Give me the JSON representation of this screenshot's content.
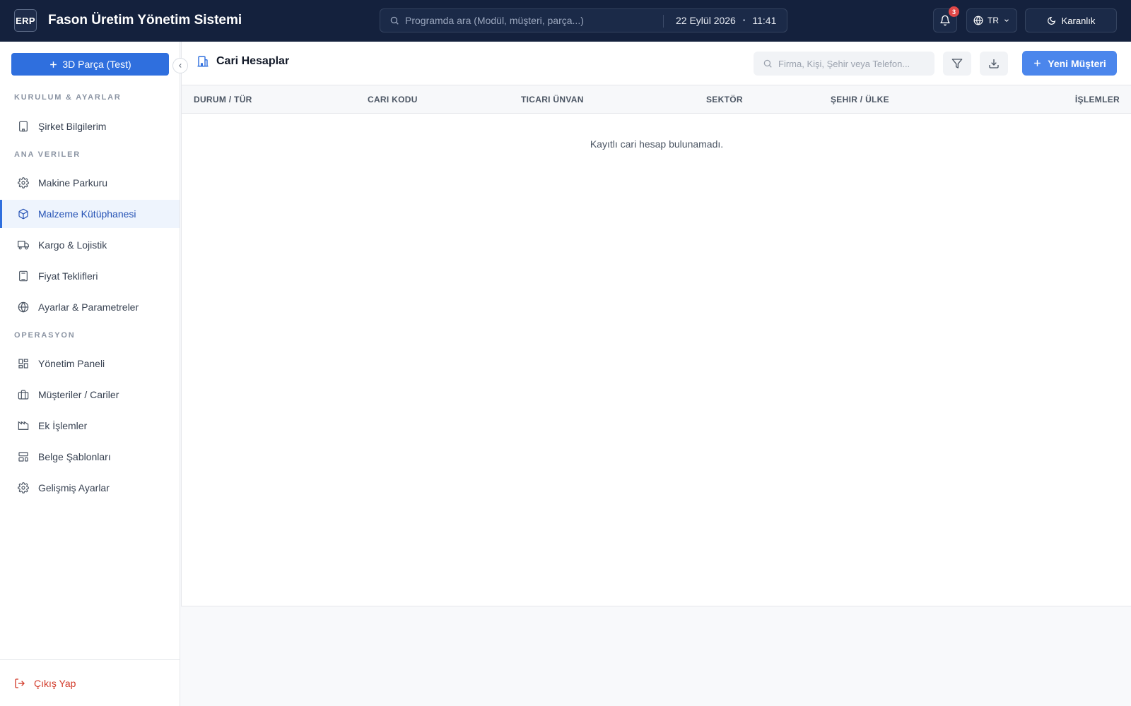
{
  "topbar": {
    "logo": "ERP",
    "app_title": "Fason Üretim Yönetim Sistemi",
    "search_placeholder": "Programda ara (Modül, müşteri, parça...)",
    "date": "22 Eylül 2026",
    "time": "11:41",
    "notification_count": "3",
    "language": "TR",
    "theme_label": "Karanlık"
  },
  "sidebar": {
    "primary_button": "3D Parça (Test)",
    "sections": [
      {
        "label": "KURULUM & AYARLAR"
      },
      {
        "label": "ANA VERILER"
      },
      {
        "label": "OPERASYON"
      }
    ],
    "items": [
      {
        "label": "Şirket Bilgilerim",
        "icon": "building-icon"
      },
      {
        "label": "Makine Parkuru",
        "icon": "gear-icon"
      },
      {
        "label": "Malzeme Kütüphanesi",
        "icon": "box-icon",
        "active": true
      },
      {
        "label": "Kargo & Lojistik",
        "icon": "truck-icon"
      },
      {
        "label": "Fiyat Teklifleri",
        "icon": "calculator-icon"
      },
      {
        "label": "Ayarlar & Parametreler",
        "icon": "globe-icon"
      },
      {
        "label": "Yönetim Paneli",
        "icon": "dashboard-icon"
      },
      {
        "label": "Müşteriler / Cariler",
        "icon": "briefcase-icon"
      },
      {
        "label": "Ek İşlemler",
        "icon": "factory-icon"
      },
      {
        "label": "Belge Şablonları",
        "icon": "template-icon"
      },
      {
        "label": "Gelişmiş Ayarlar",
        "icon": "gear-icon"
      }
    ],
    "logout": "Çıkış Yap"
  },
  "main": {
    "page_title": "Cari Hesaplar",
    "search_placeholder": "Firma, Kişi, Şehir veya Telefon...",
    "new_button": "Yeni Müşteri",
    "columns": [
      "DURUM / TÜR",
      "CARI KODU",
      "TICARI ÜNVAN",
      "SEKTÖR",
      "ŞEHIR / ÜLKE",
      "İŞLEMLER"
    ],
    "empty_message": "Kayıtlı cari hesap bulunamadı."
  },
  "colors": {
    "topbar_bg": "#14213d",
    "accent": "#2f6fde",
    "active_nav_bg": "#eef4fd",
    "danger": "#d23a2a"
  }
}
